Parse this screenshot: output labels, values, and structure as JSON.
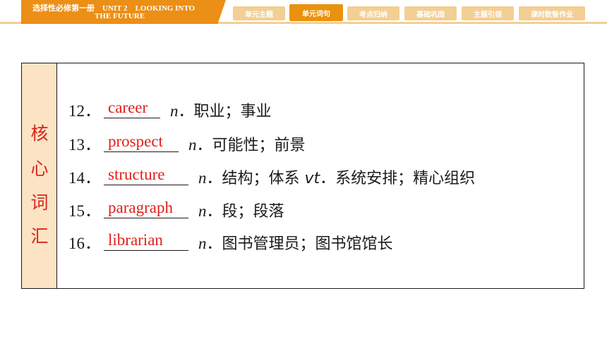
{
  "header": {
    "title_line1": "选择性必修第一册　UNIT 2　LOOKING INTO",
    "title_line2": "THE FUTURE",
    "tabs": [
      {
        "label": "单元主题",
        "active": false
      },
      {
        "label": "单元词句",
        "active": true
      },
      {
        "label": "考点归纳",
        "active": false
      },
      {
        "label": "基础巩固",
        "active": false
      },
      {
        "label": "主题引领",
        "active": false
      },
      {
        "label": "课时数智作业",
        "active": false
      }
    ]
  },
  "panel": {
    "side_label": [
      "核",
      "心",
      "词",
      "汇"
    ],
    "items": [
      {
        "num": "12．",
        "answer": "career",
        "pos": "n",
        "meaning": "．职业；事业",
        "extra_pos": "",
        "extra_meaning": ""
      },
      {
        "num": "13．",
        "answer": "prospect",
        "pos": "n",
        "meaning": "．可能性；前景",
        "extra_pos": "",
        "extra_meaning": ""
      },
      {
        "num": "14．",
        "answer": "structure",
        "pos": "n",
        "meaning": "．结构；体系 ",
        "extra_pos": "vt",
        "extra_meaning": "．系统安排；精心组织"
      },
      {
        "num": "15．",
        "answer": "paragraph",
        "pos": "n",
        "meaning": "．段；段落",
        "extra_pos": "",
        "extra_meaning": ""
      },
      {
        "num": "16．",
        "answer": "librarian",
        "pos": "n",
        "meaning": "．图书管理员；图书馆馆长",
        "extra_pos": "",
        "extra_meaning": ""
      }
    ]
  },
  "colors": {
    "accent_orange": "#eb8f16",
    "tab_light": "#f3cf94",
    "side_bg": "#fbe3c4",
    "answer_red": "#e0201a"
  }
}
